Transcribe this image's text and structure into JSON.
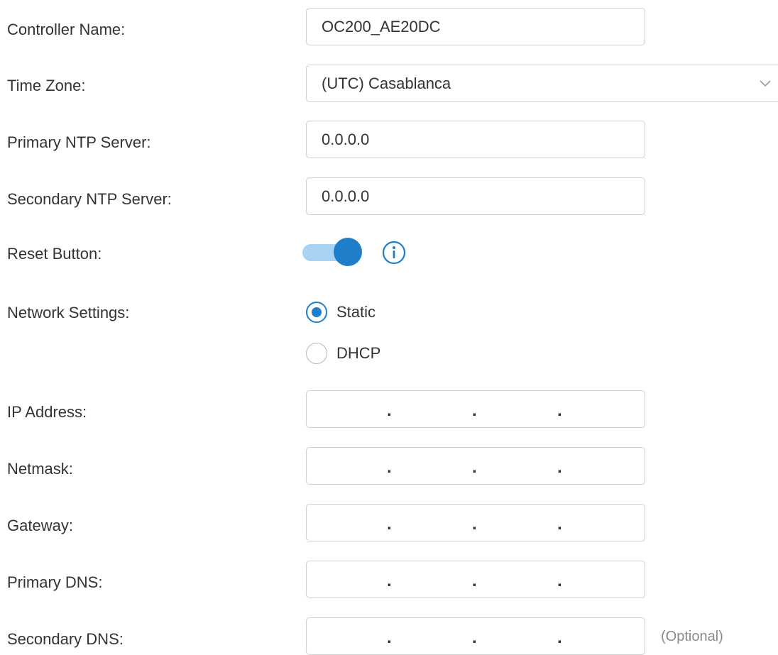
{
  "form": {
    "controller_name": {
      "label": "Controller Name:",
      "value": "OC200_AE20DC"
    },
    "time_zone": {
      "label": "Time Zone:",
      "value": "(UTC) Casablanca"
    },
    "primary_ntp": {
      "label": "Primary NTP Server:",
      "value": "0.0.0.0"
    },
    "secondary_ntp": {
      "label": "Secondary NTP Server:",
      "value": "0.0.0.0"
    },
    "reset_button": {
      "label": "Reset Button:",
      "enabled": true
    },
    "network_settings": {
      "label": "Network Settings:",
      "options": [
        {
          "label": "Static",
          "selected": true
        },
        {
          "label": "DHCP",
          "selected": false
        }
      ]
    },
    "ip_address": {
      "label": "IP Address:",
      "separator": "."
    },
    "netmask": {
      "label": "Netmask:",
      "separator": "."
    },
    "gateway": {
      "label": "Gateway:",
      "separator": "."
    },
    "primary_dns": {
      "label": "Primary DNS:",
      "separator": "."
    },
    "secondary_dns": {
      "label": "Secondary DNS:",
      "separator": ".",
      "hint": "(Optional)"
    }
  },
  "colors": {
    "accent": "#1f7ec9",
    "accent_light": "#a9d3f2",
    "text": "#333333",
    "border": "#cfcfcf",
    "hint": "#8a8a8a"
  },
  "icons": {
    "time_zone_dropdown": "chevron-down-icon",
    "reset_info": "info-icon"
  }
}
